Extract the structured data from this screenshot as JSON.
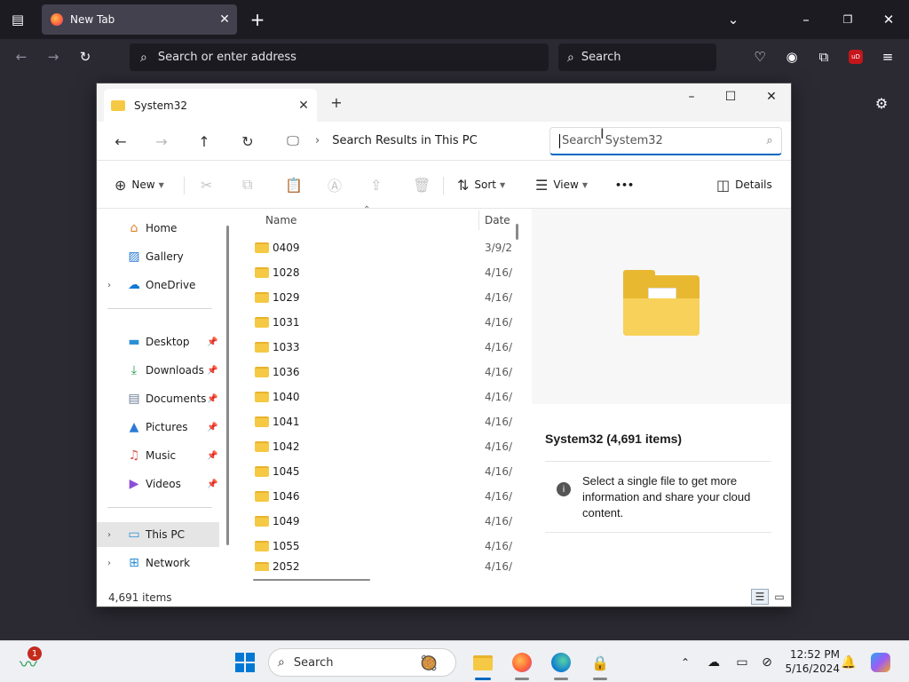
{
  "browser": {
    "tab_title": "New Tab",
    "tab_close": "✕",
    "new_tab": "+",
    "address_placeholder": "Search or enter address",
    "search_placeholder": "Search"
  },
  "explorer": {
    "tab_title": "System32",
    "tab_close": "✕",
    "new_tab": "+",
    "breadcrumb": "Search Results in This PC",
    "breadcrumb_sep": "›",
    "search_placeholder": "Search System32",
    "commands": {
      "new": "New",
      "sort": "Sort",
      "view": "View",
      "more": "•••",
      "details": "Details"
    },
    "nav": {
      "quick": [
        {
          "label": "Home"
        },
        {
          "label": "Gallery"
        },
        {
          "label": "OneDrive"
        }
      ],
      "pinned": [
        {
          "label": "Desktop"
        },
        {
          "label": "Downloads"
        },
        {
          "label": "Documents"
        },
        {
          "label": "Pictures"
        },
        {
          "label": "Music"
        },
        {
          "label": "Videos"
        }
      ],
      "devices": [
        {
          "label": "This PC"
        },
        {
          "label": "Network"
        }
      ]
    },
    "columns": {
      "name": "Name",
      "date": "Date"
    },
    "files": [
      {
        "name": "0409",
        "date": "3/9/2"
      },
      {
        "name": "1028",
        "date": "4/16/"
      },
      {
        "name": "1029",
        "date": "4/16/"
      },
      {
        "name": "1031",
        "date": "4/16/"
      },
      {
        "name": "1033",
        "date": "4/16/"
      },
      {
        "name": "1036",
        "date": "4/16/"
      },
      {
        "name": "1040",
        "date": "4/16/"
      },
      {
        "name": "1041",
        "date": "4/16/"
      },
      {
        "name": "1042",
        "date": "4/16/"
      },
      {
        "name": "1045",
        "date": "4/16/"
      },
      {
        "name": "1046",
        "date": "4/16/"
      },
      {
        "name": "1049",
        "date": "4/16/"
      },
      {
        "name": "1055",
        "date": "4/16/"
      },
      {
        "name": "2052",
        "date": "4/16/"
      }
    ],
    "details": {
      "title": "System32 (4,691 items)",
      "info": "Select a single file to get more information and share your cloud content."
    },
    "status_count": "4,691 items"
  },
  "taskbar": {
    "search_placeholder": "Search",
    "notification_count": "1",
    "time": "12:52 PM",
    "date": "5/16/2024"
  },
  "colors": {
    "accent": "#0067c0",
    "folder": "#f5c944",
    "browser_bg": "#2b2a33"
  }
}
